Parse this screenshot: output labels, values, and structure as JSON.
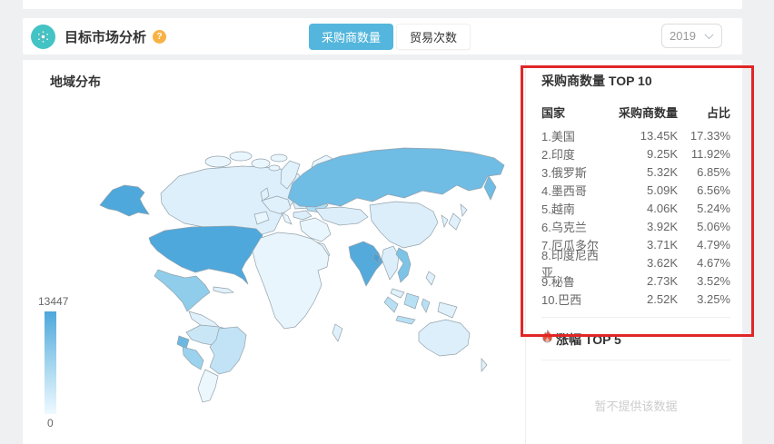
{
  "header": {
    "title": "目标市场分析",
    "help_text": "?",
    "toggle": {
      "option_active": "采购商数量",
      "option_inactive": "贸易次数"
    },
    "year": "2019"
  },
  "map_section": {
    "title": "地域分布",
    "legend_max": "13447",
    "legend_min": "0"
  },
  "top10": {
    "title": "采购商数量 TOP 10",
    "col_country": "国家",
    "col_value": "采购商数量",
    "col_share": "占比",
    "rows": [
      {
        "label": "1.美国",
        "value": "13.45K",
        "share": "17.33%"
      },
      {
        "label": "2.印度",
        "value": "9.25K",
        "share": "11.92%"
      },
      {
        "label": "3.俄罗斯",
        "value": "5.32K",
        "share": "6.85%"
      },
      {
        "label": "4.墨西哥",
        "value": "5.09K",
        "share": "6.56%"
      },
      {
        "label": "5.越南",
        "value": "4.06K",
        "share": "5.24%"
      },
      {
        "label": "6.乌克兰",
        "value": "3.92K",
        "share": "5.06%"
      },
      {
        "label": "7.厄瓜多尔",
        "value": "3.71K",
        "share": "4.79%"
      },
      {
        "label": "8.印度尼西亚",
        "value": "3.62K",
        "share": "4.67%"
      },
      {
        "label": "9.秘鲁",
        "value": "2.73K",
        "share": "3.52%"
      },
      {
        "label": "10.巴西",
        "value": "2.52K",
        "share": "3.25%"
      }
    ]
  },
  "rise_section": {
    "title": "涨幅 TOP 5"
  },
  "empty_state": {
    "message": "暂不提供该数据"
  },
  "chart_data": {
    "type": "heatmap",
    "subtype": "choropleth-world-map",
    "title": "地域分布",
    "value_label": "采购商数量",
    "scale": {
      "min": 0,
      "max": 13447
    },
    "categories": [
      "美国",
      "印度",
      "俄罗斯",
      "墨西哥",
      "越南",
      "乌克兰",
      "厄瓜多尔",
      "印度尼西亚",
      "秘鲁",
      "巴西"
    ],
    "values": [
      13450,
      9250,
      5320,
      5090,
      4060,
      3920,
      3710,
      3620,
      2730,
      2520
    ],
    "shares_pct": [
      17.33,
      11.92,
      6.85,
      6.56,
      5.24,
      5.06,
      4.79,
      4.67,
      3.52,
      3.25
    ],
    "legend_position": "bottom-left"
  },
  "colors": {
    "accent_teal": "#44c3c4",
    "toggle_active": "#54b6dc",
    "help_orange": "#f9b244",
    "flame_red": "#f4502f",
    "annotation_red": "#e12626",
    "map_scale_high": "#4da7db",
    "map_scale_low": "#eef9ff",
    "map_base": "#e1f1fb"
  }
}
